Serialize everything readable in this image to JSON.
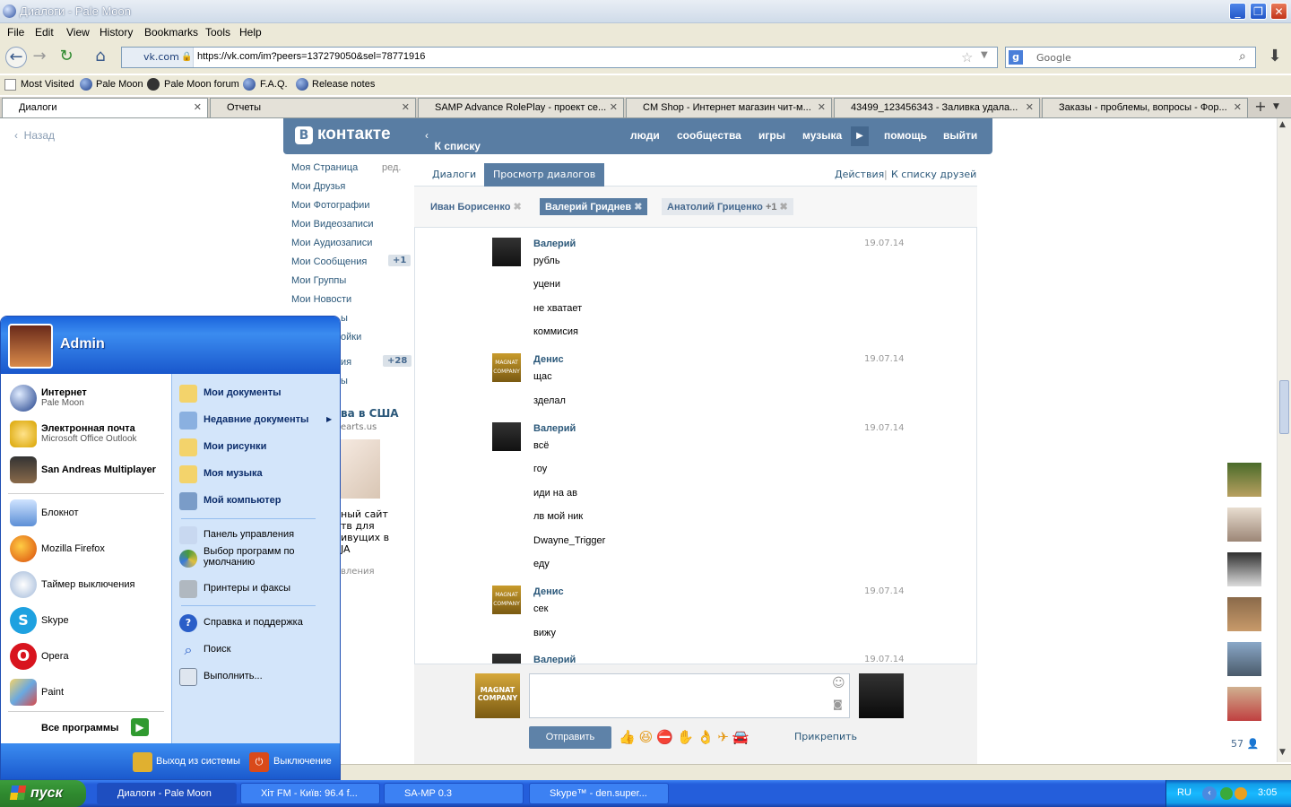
{
  "window": {
    "title": "Диалоги - Pale Moon"
  },
  "menu": [
    "File",
    "Edit",
    "View",
    "History",
    "Bookmarks",
    "Tools",
    "Help"
  ],
  "nav": {
    "site": "vk.com",
    "url": "https://vk.com/im?peers=137279050&sel=78771916",
    "search_placeholder": "Google"
  },
  "bookmarks": [
    "Most Visited",
    "Pale Moon",
    "Pale Moon forum",
    "F.A.Q.",
    "Release notes"
  ],
  "tabs": [
    "Диалоги",
    "Отчеты",
    "SAMP Advance RolePlay - проект се...",
    "CM Shop - Интернет магазин чит-м...",
    "43499_123456343 - Заливка удала...",
    "Заказы - проблемы, вопросы - Фор..."
  ],
  "vk": {
    "back": "Назад",
    "logo": "контакте",
    "back_to_list": "К списку диалогов",
    "top_nav": [
      "люди",
      "сообщества",
      "игры",
      "музыка",
      "помощь",
      "выйти"
    ],
    "left_menu": [
      "Моя Страница",
      "Мои Друзья",
      "Мои Фотографии",
      "Мои Видеозаписи",
      "Мои Аудиозаписи",
      "Мои Сообщения",
      "Мои Группы",
      "Мои Новости",
      "ы",
      "ойки",
      "ия",
      "ы"
    ],
    "edit": "ред.",
    "msg_badge": "+1",
    "badge2": "+28",
    "ad_title": "ва в США",
    "ad_site": "earts.us",
    "ad_text": [
      "ный сайт",
      "тв для",
      "ивущих в",
      "JA"
    ],
    "ad_footer": "вления",
    "tab_dialogs": "Диалоги",
    "tab_view": "Просмотр диалогов",
    "actions": "Действия",
    "sep": "|",
    "to_friends": "К списку друзей",
    "peers": [
      "Иван Борисенко",
      "Валерий Гриднев",
      "Анатолий Гриценко",
      "+1"
    ],
    "messages": [
      {
        "name": "Валерий",
        "date": "19.07.14",
        "lines": [
          "рубль",
          "уцени",
          "не хватает",
          "коммисия"
        ]
      },
      {
        "name": "Денис",
        "date": "19.07.14",
        "lines": [
          "щас",
          "зделал"
        ]
      },
      {
        "name": "Валерий",
        "date": "19.07.14",
        "lines": [
          "всё",
          "гоу",
          "иди на ав",
          "лв мой ник",
          "Dwayne_Trigger",
          "еду"
        ]
      },
      {
        "name": "Денис",
        "date": "19.07.14",
        "lines": [
          "сек",
          "вижу"
        ]
      },
      {
        "name": "Валерий",
        "date": "19.07.14",
        "lines": []
      }
    ],
    "send": "Отправить",
    "attach": "Прикрепить",
    "online_count": "57",
    "avatar_text": "MAGNAT COMPANY"
  },
  "startmenu": {
    "user": "Admin",
    "pinned": [
      {
        "title": "Интернет",
        "sub": "Pale Moon"
      },
      {
        "title": "Электронная почта",
        "sub": "Microsoft Office Outlook"
      },
      {
        "title": "San Andreas Multiplayer",
        "sub": ""
      }
    ],
    "recent": [
      "Блокнот",
      "Mozilla Firefox",
      "Таймер выключения",
      "Skype",
      "Opera",
      "Paint"
    ],
    "all_programs": "Все программы",
    "right_bold": [
      "Мои документы",
      "Недавние документы",
      "Мои рисунки",
      "Моя музыка",
      "Мой компьютер"
    ],
    "right": [
      "Панель управления",
      "Выбор программ по",
      "умолчанию",
      "Принтеры и факсы",
      "Справка и поддержка",
      "Поиск",
      "Выполнить..."
    ],
    "logoff": "Выход из системы",
    "shutdown": "Выключение"
  },
  "taskbar": {
    "start": "пуск",
    "items": [
      "Диалоги - Pale Moon",
      "Хіт FM - Київ: 96.4 f...",
      "SA-MP 0.3",
      "Skype™ - den.super..."
    ],
    "lang": "RU",
    "time": "3:05"
  }
}
